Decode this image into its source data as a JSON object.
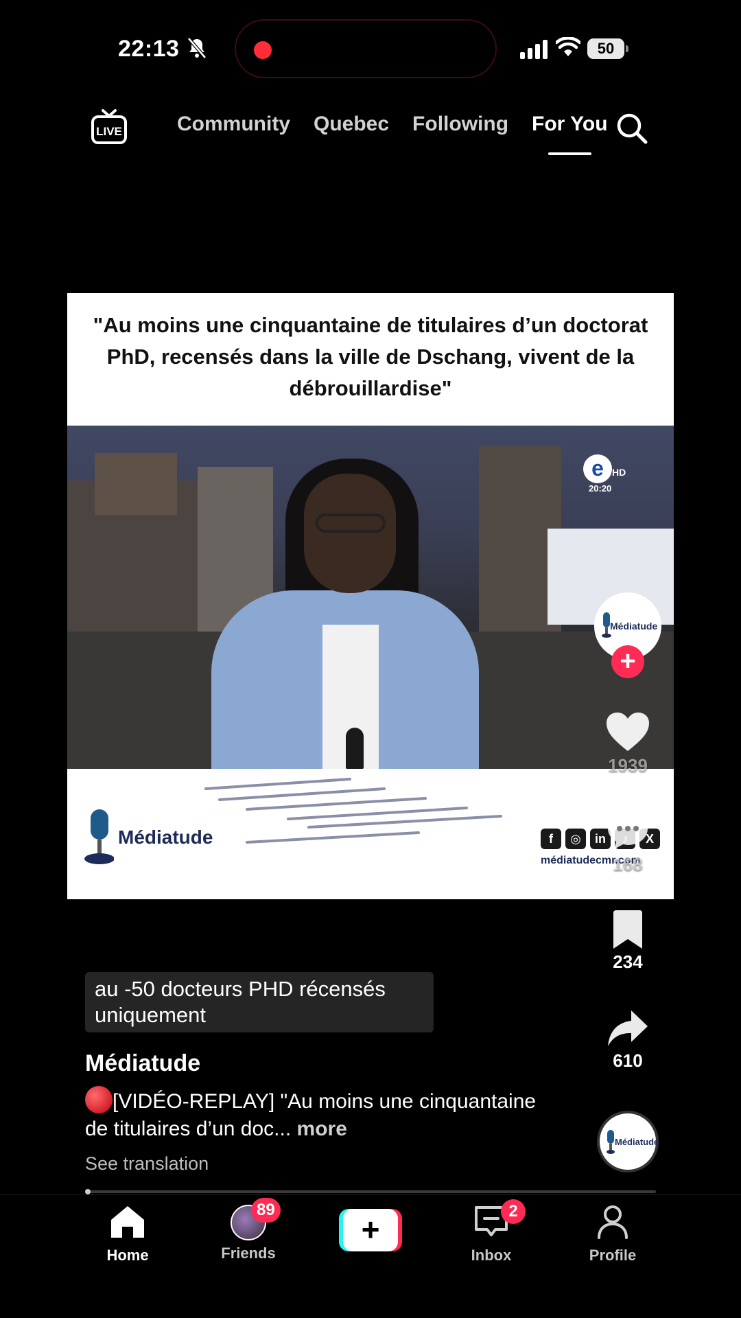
{
  "status_bar": {
    "time": "22:13",
    "battery": "50"
  },
  "top_nav": {
    "live_label": "LIVE",
    "tabs": [
      {
        "label": "Community"
      },
      {
        "label": "Quebec"
      },
      {
        "label": "Following"
      },
      {
        "label": "For You",
        "active": true
      }
    ]
  },
  "video": {
    "headline": "\"Au moins une cinquantaine de titulaires d’un doctorat PhD, recensés dans la ville de Dschang, vivent de la débrouillardise\"",
    "channel_badge": {
      "letter": "e",
      "suffix": "HD",
      "clock": "20:20"
    },
    "brand_name": "Médiatude",
    "social_icons": [
      "f",
      "◎",
      "in",
      "♪",
      "X"
    ],
    "website": "médiatudecmr.com"
  },
  "right_rail": {
    "avatar_label": "Médiatude",
    "likes": "1939",
    "comments": "168",
    "bookmarks": "234",
    "shares": "610",
    "music_label": "Médiatude"
  },
  "caption": {
    "sticker_text": "au -50 docteurs PHD récensés uniquement",
    "author": "Médiatude",
    "description": "[VIDÉO-REPLAY] \"Au moins une cinquantaine de titulaires d’un doc...",
    "more_label": "more",
    "see_translation": "See translation",
    "playback_progress": 0.01
  },
  "bottom_nav": {
    "home": "Home",
    "friends": "Friends",
    "friends_badge": "89",
    "inbox": "Inbox",
    "inbox_badge": "2",
    "profile": "Profile",
    "create_symbol": "+"
  },
  "colors": {
    "accent": "#fe2c55",
    "accent_cyan": "#25f4ee",
    "brand_navy": "#1d2b5a"
  }
}
